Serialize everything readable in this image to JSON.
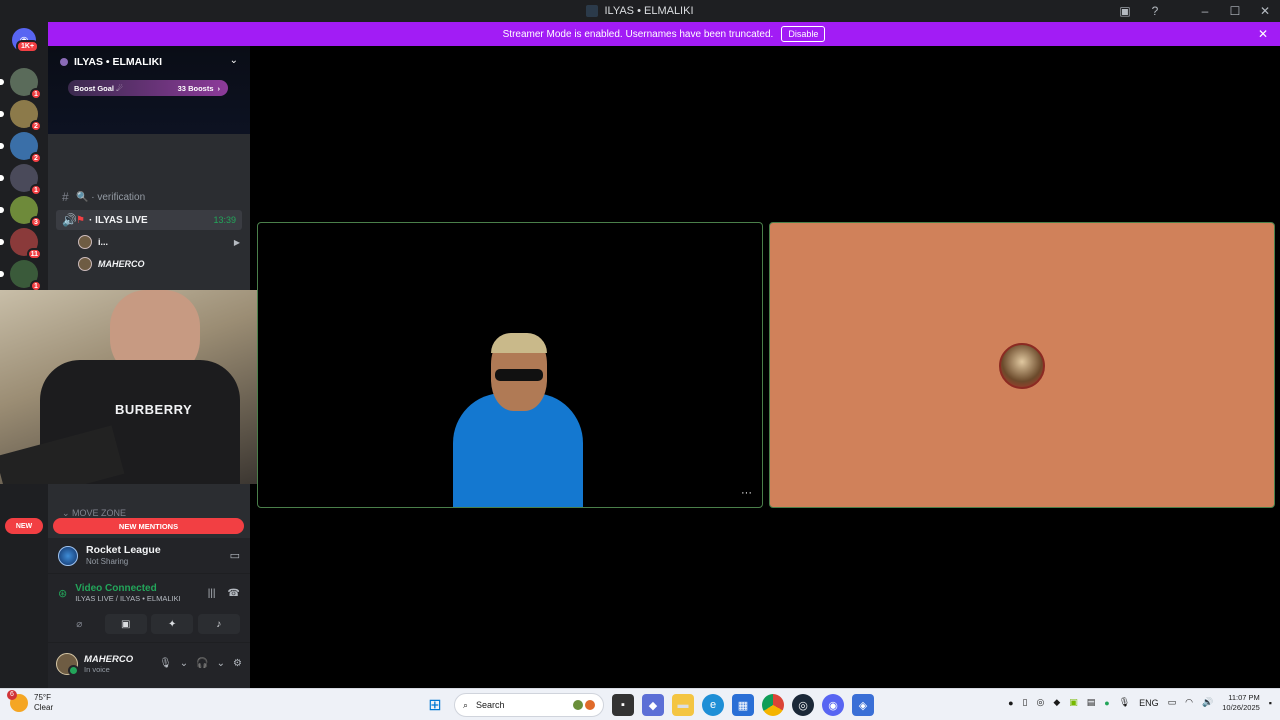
{
  "window": {
    "title": "ILYAS • ELMALIKI"
  },
  "banner": {
    "text": "Streamer Mode is enabled. Usernames have been truncated.",
    "disable_label": "Disable"
  },
  "rail": {
    "home_badge": "1K+",
    "servers": [
      {
        "badge": "1",
        "color": "#5a6b5a"
      },
      {
        "badge": "2",
        "color": "#8c7a4a"
      },
      {
        "badge": "2",
        "color": "#3a6fa8"
      },
      {
        "badge": "1",
        "color": "#4a4a5a"
      },
      {
        "badge": "3",
        "color": "#6e8a3a"
      },
      {
        "badge": "11",
        "color": "#8a3a3a"
      },
      {
        "badge": "1",
        "color": "#3a5a3a"
      }
    ]
  },
  "sidebar": {
    "server_name": "ILYAS • ELMALIKI",
    "boost_goal": "Boost Goal",
    "boost_count": "33 Boosts",
    "channels": [
      {
        "name": "verification",
        "prefix": "🔍 ·"
      },
      {
        "name": "ILYAS LIVE",
        "prefix": "·",
        "time": "13:39"
      }
    ],
    "voice_users": [
      {
        "name": "i..."
      },
      {
        "name": "MAHERCO"
      }
    ],
    "cam_text": "BURBERRY",
    "move_zone": "MOVE ZONE",
    "new_label": "NEW",
    "new_mentions": "NEW MENTIONS"
  },
  "activity": {
    "game": "Rocket League",
    "status": "Not Sharing"
  },
  "voice": {
    "status": "Video Connected",
    "channel": "ILYAS LIVE / ILYAS • ELMALIKI"
  },
  "user": {
    "name": "MAHERCO",
    "status": "In voice"
  },
  "taskbar": {
    "weather_temp": "75°F",
    "weather_desc": "Clear",
    "weather_badge": "6",
    "search_placeholder": "Search",
    "lang": "ENG",
    "time": "11:07 PM",
    "date": "10/26/2025"
  },
  "colors": {
    "banner": "#a21cf5",
    "mention": "#f23f43",
    "connected": "#23a55a",
    "tile_border": "#4a7f4a",
    "tile_bg": "#d0815a"
  }
}
